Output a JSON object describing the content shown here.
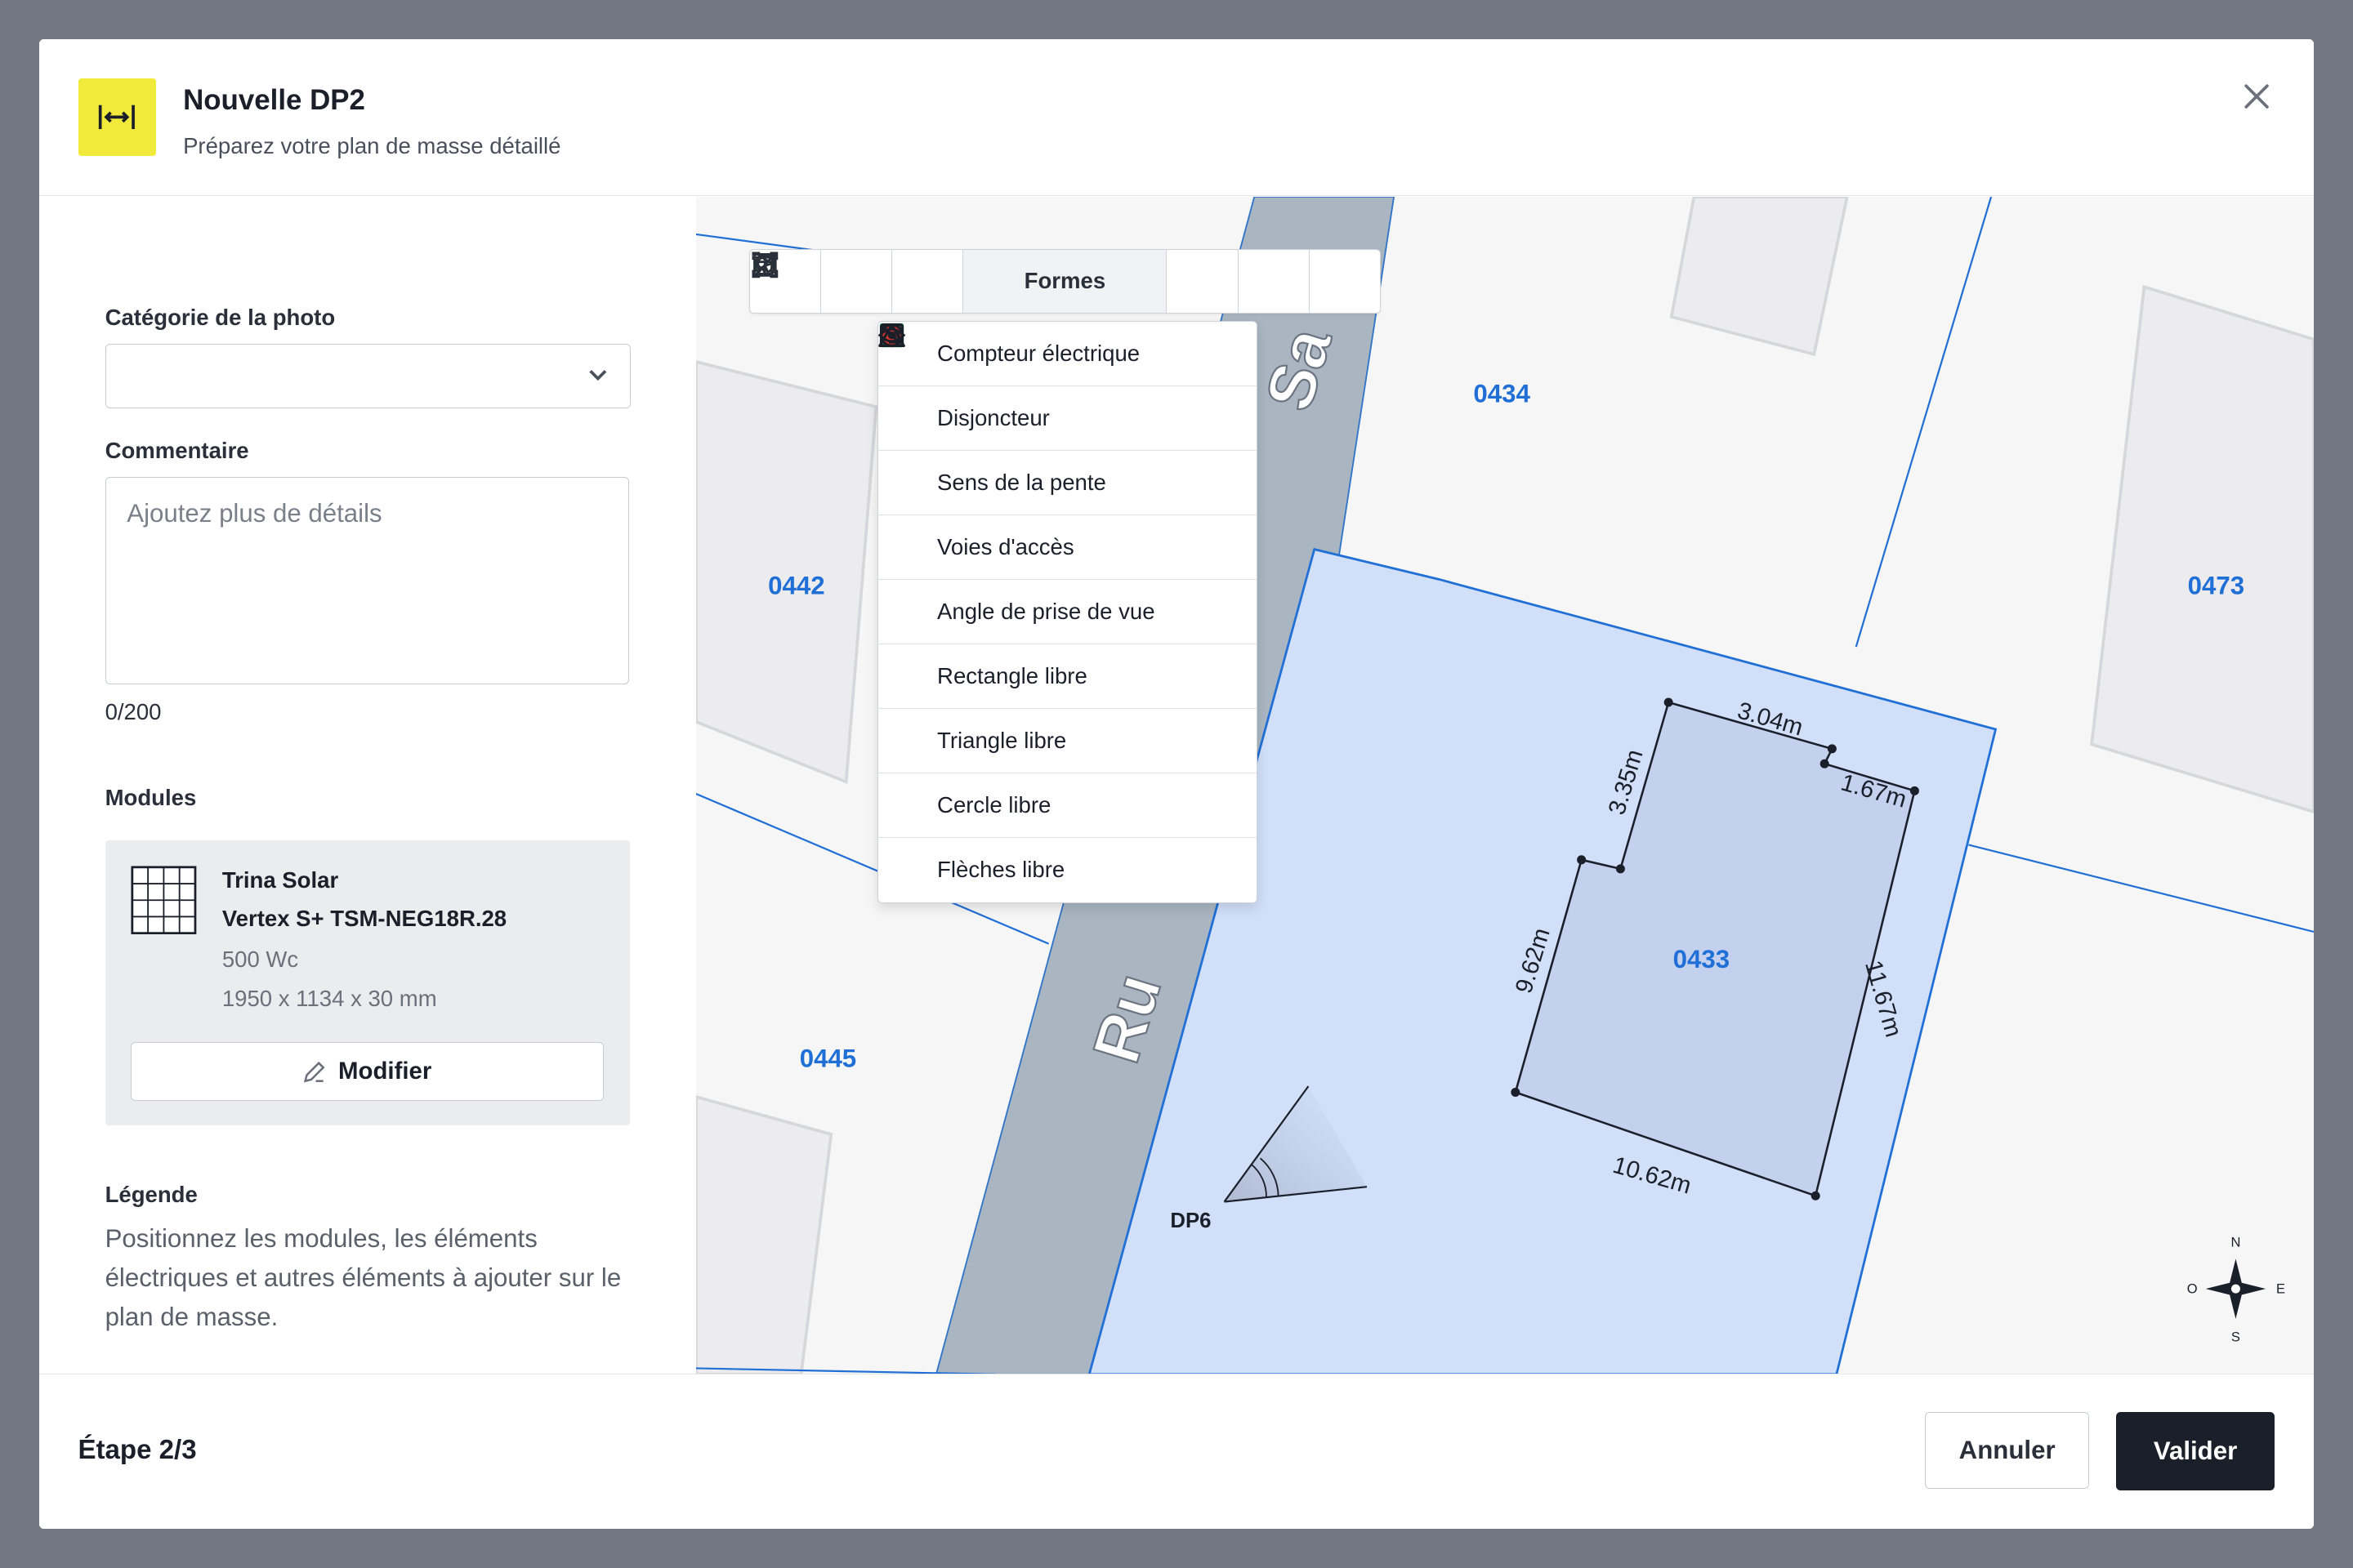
{
  "header": {
    "title": "Nouvelle DP2",
    "subtitle": "Préparez votre plan de masse détaillé",
    "icon": "horizontal-measure-icon",
    "accent_color": "#f2ea3a"
  },
  "form": {
    "photo_category_label": "Catégorie de la photo",
    "photo_category_value": "",
    "comment_label": "Commentaire",
    "comment_placeholder": "Ajoutez plus de détails",
    "comment_counter": "0/200",
    "modules_label": "Modules",
    "module": {
      "brand": "Trina Solar",
      "model": "Vertex S+ TSM-NEG18R.28",
      "power": "500 Wc",
      "dimensions": "1950 x 1134 x 30 mm",
      "edit_label": "Modifier"
    },
    "legend_label": "Légende",
    "legend_text": "Positionnez les modules, les éléments électriques et autres éléments à ajouter sur le plan de masse."
  },
  "toolbar": {
    "tools": [
      "select-icon",
      "transform-icon",
      "line-icon",
      "shapes-icon",
      "text-icon",
      "undo-icon",
      "trash-icon"
    ],
    "shapes_label": "Formes"
  },
  "shapes_menu": {
    "items": [
      {
        "label": "Compteur électrique",
        "icon": "green-square-icon",
        "color": "#1e9e54"
      },
      {
        "label": "Disjoncteur",
        "icon": "red-circle-icon",
        "color": "#e0352b"
      },
      {
        "label": "Sens de la pente",
        "icon": "orange-arrow-icon",
        "color": "#e07b12"
      },
      {
        "label": "Voies d'accès",
        "icon": "dotted-line-icon"
      },
      {
        "label": "Angle de prise de vue",
        "icon": "eye-icon"
      },
      {
        "label": "Rectangle libre",
        "icon": "square-outline-icon"
      },
      {
        "label": "Triangle libre",
        "icon": "triangle-outline-icon"
      },
      {
        "label": "Cercle libre",
        "icon": "circle-outline-icon"
      },
      {
        "label": "Flèches libre",
        "icon": "arrow-down-right-icon"
      }
    ]
  },
  "map": {
    "street_name": "Rue … Sa…",
    "parcels": [
      "0434",
      "0442",
      "0473",
      "0433",
      "0445"
    ],
    "roof_dimensions": [
      "3.04m",
      "1.67m",
      "3.35m",
      "9.62m",
      "11.67m",
      "10.62m"
    ],
    "viewpoint_label": "DP6",
    "compass": {
      "n": "N",
      "e": "E",
      "s": "S",
      "w": "O"
    },
    "parcel_color": "#1f6fd6",
    "selected_parcel_fill": "#d1dff8"
  },
  "footer": {
    "step": "Étape 2/3",
    "cancel_label": "Annuler",
    "confirm_label": "Valider"
  }
}
